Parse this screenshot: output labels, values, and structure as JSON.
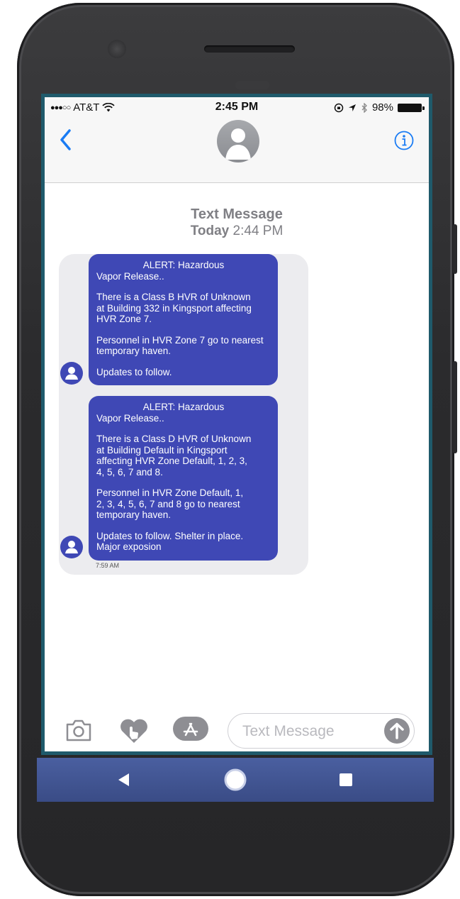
{
  "status_bar": {
    "carrier": "AT&T",
    "time": "2:45 PM",
    "battery": "98%"
  },
  "conversation": {
    "type_label": "Text Message",
    "date_label": "Today",
    "date_time": "2:44 PM"
  },
  "messages": [
    {
      "title": "ALERT: Hazardous",
      "lines": [
        "Vapor Release..",
        "There is a Class B HVR of Unknown\nat Building 332 in Kingsport affecting\nHVR Zone 7.",
        "Personnel in HVR Zone 7 go to nearest\ntemporary haven.",
        "Updates to follow."
      ]
    },
    {
      "title": "ALERT: Hazardous",
      "lines": [
        "Vapor Release..",
        "There is a Class D HVR of Unknown\nat Building Default in Kingsport\naffecting HVR Zone Default, 1, 2, 3,\n4, 5, 6, 7 and 8.",
        "Personnel in HVR Zone Default, 1,\n2, 3, 4, 5, 6, 7 and 8 go to nearest\ntemporary haven.",
        "Updates to follow.   Shelter in place.\nMajor exposion"
      ],
      "time": "7:59 AM"
    }
  ],
  "compose": {
    "placeholder": "Text Message"
  },
  "icons": {
    "back": "chevron-left-icon",
    "info": "info-icon",
    "camera": "camera-icon",
    "digital_touch": "heart-hand-icon",
    "app_store": "app-store-icon",
    "send": "arrow-up-icon",
    "nav_back": "triangle-back-icon",
    "nav_home": "circle-home-icon",
    "nav_recents": "square-recents-icon"
  },
  "colors": {
    "bubble": "#3f48b5",
    "ios_blue": "#1a7cf4",
    "android_nav": "#3a4c86"
  }
}
